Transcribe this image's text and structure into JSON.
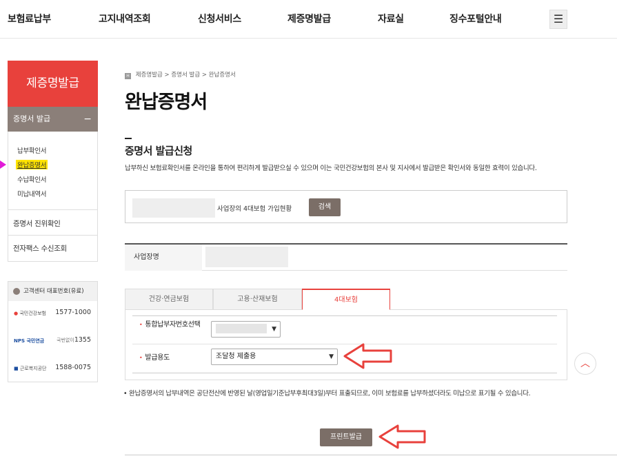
{
  "topnav": {
    "items": [
      "보험료납부",
      "고지내역조회",
      "신청서비스",
      "제증명발급",
      "자료실",
      "징수포털안내"
    ],
    "menu_icon": "hamburger-icon"
  },
  "sidebar": {
    "title": "제증명발급",
    "sub_title": "증명서 발급",
    "sub_toggle": "−",
    "links": [
      "납부확인서",
      "완납증명서",
      "수납확인서",
      "미납내역서"
    ],
    "active_link": "완납증명서",
    "extra_links": [
      "증명서 진위확인",
      "전자팩스 수신조회"
    ]
  },
  "contact": {
    "title": "고객센터 대표번호(유료)",
    "rows": [
      {
        "logo": "국민건강보험",
        "prefix": "",
        "number": "1577-1000"
      },
      {
        "logo": "NPS 국민연금",
        "prefix": "국번없이",
        "number": "1355"
      },
      {
        "logo": "근로복지공단",
        "prefix": "",
        "number": "1588-0075"
      }
    ]
  },
  "breadcrumb": [
    "제증명발급",
    "증명서 발급",
    "완납증명서"
  ],
  "page_title": "완납증명서",
  "section_title": "증명서 발급신청",
  "description": "납부하신 보험료확인서를 온라인을 통하여 편리하게 발급받으실 수 있으며 이는 국민건강보험의 본사 및 지사에서 발급받은 확인서와 동일한 효력이 있습니다.",
  "search": {
    "label": "사업장의 4대보험 가입현황",
    "button": "검색"
  },
  "biz": {
    "label": "사업장명"
  },
  "tabs": [
    "건강·연금보험",
    "고용·산재보험",
    "4대보험"
  ],
  "active_tab": "4대보험",
  "form": {
    "payer_label": "통합납부자번호선택",
    "purpose_label": "발급용도",
    "purpose_value": "조달청 제출용"
  },
  "note": "완납증명서의 납부내역은 공단전산에 반영된 날(영업일기준납부후최대3일)부터 표출되므로, 이미 보험료를 납부하셨더라도 미납으로 표기될 수 있습니다.",
  "print_button": "프린트발급",
  "scroll_top": "︿",
  "colors": {
    "accent": "#e8413c",
    "button": "#7b6e67",
    "sidebar_sub": "#8b7f79",
    "highlight": "#ffe400",
    "annotation": "#e8413c"
  }
}
